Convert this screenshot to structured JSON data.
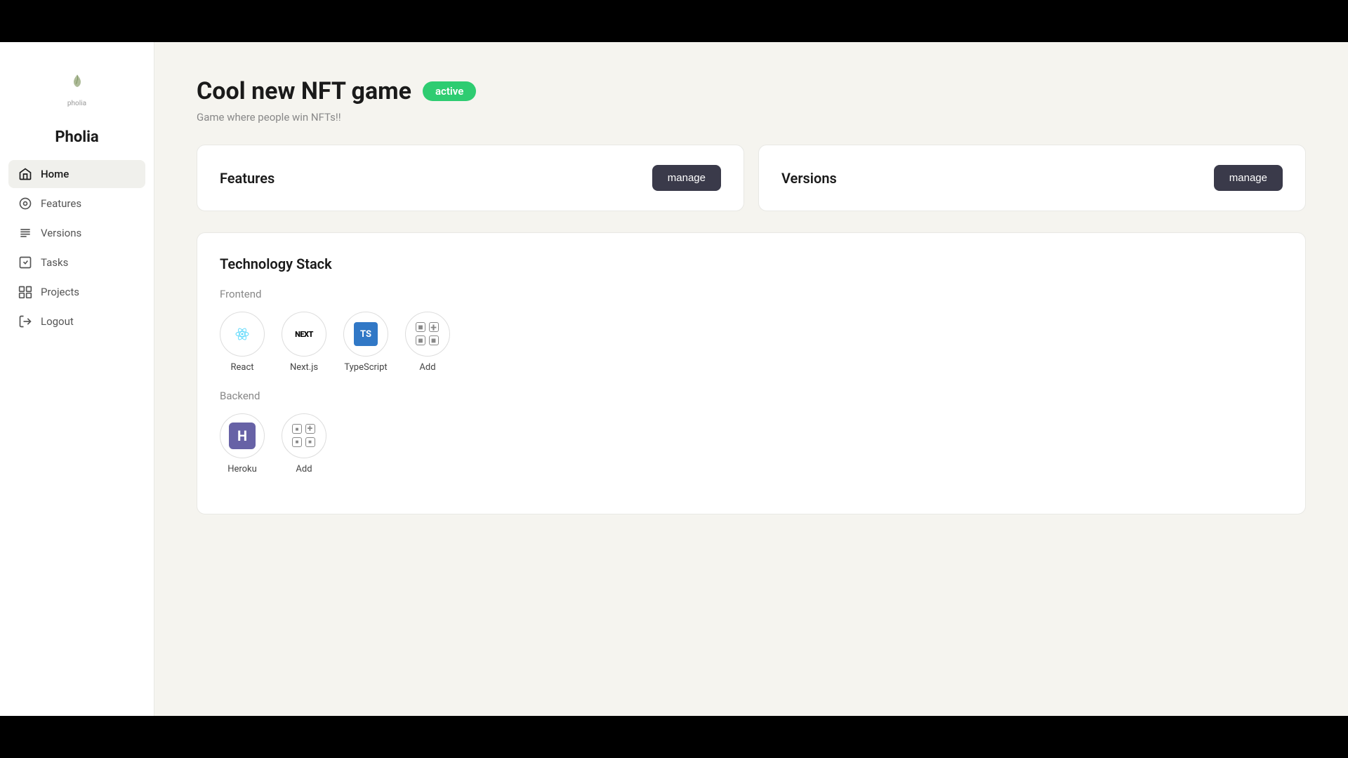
{
  "brand": {
    "logo_label": "pholia",
    "name": "Pholia"
  },
  "sidebar": {
    "items": [
      {
        "id": "home",
        "label": "Home",
        "icon": "home-icon",
        "active": true
      },
      {
        "id": "features",
        "label": "Features",
        "icon": "features-icon",
        "active": false
      },
      {
        "id": "versions",
        "label": "Versions",
        "icon": "versions-icon",
        "active": false
      },
      {
        "id": "tasks",
        "label": "Tasks",
        "icon": "tasks-icon",
        "active": false
      },
      {
        "id": "projects",
        "label": "Projects",
        "icon": "projects-icon",
        "active": false
      },
      {
        "id": "logout",
        "label": "Logout",
        "icon": "logout-icon",
        "active": false
      }
    ]
  },
  "page": {
    "title": "Cool new NFT game",
    "status": "active",
    "subtitle": "Game where people win NFTs!!"
  },
  "features_card": {
    "title": "Features",
    "manage_label": "manage"
  },
  "versions_card": {
    "title": "Versions",
    "manage_label": "manage"
  },
  "tech_stack": {
    "section_title": "Technology Stack",
    "frontend_label": "Frontend",
    "backend_label": "Backend",
    "frontend_items": [
      {
        "id": "react",
        "label": "React"
      },
      {
        "id": "nextjs",
        "label": "Next.js"
      },
      {
        "id": "typescript",
        "label": "TypeScript"
      },
      {
        "id": "add-frontend",
        "label": "Add"
      }
    ],
    "backend_items": [
      {
        "id": "heroku",
        "label": "Heroku"
      },
      {
        "id": "add-backend",
        "label": "Add"
      }
    ]
  },
  "colors": {
    "active_badge_bg": "#2ecc71",
    "manage_btn_bg": "#3a3a4a",
    "react_color": "#61dafb",
    "ts_color": "#3178c6",
    "heroku_color": "#6762a6"
  }
}
